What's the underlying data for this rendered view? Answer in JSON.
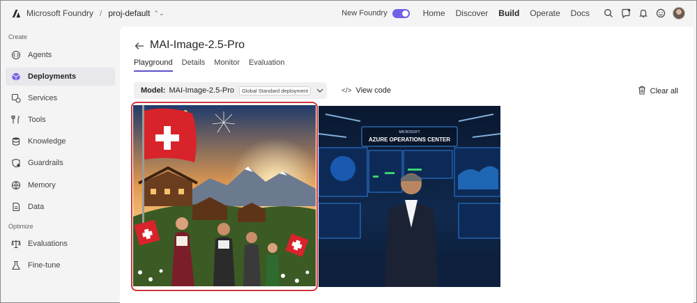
{
  "topbar": {
    "brand": "Microsoft Foundry",
    "separator": "/",
    "project": "proj-default",
    "new_foundry_label": "New Foundry",
    "new_foundry_on": true,
    "nav": [
      "Home",
      "Discover",
      "Build",
      "Operate",
      "Docs"
    ],
    "active_nav": "Build",
    "icons": [
      "search-icon",
      "chat-bubble-icon",
      "bell-icon",
      "smiley-icon",
      "avatar"
    ],
    "accent_color": "#7160e8"
  },
  "sidebar": {
    "sections": [
      {
        "label": "Create",
        "items": [
          {
            "label": "Agents",
            "icon": "agents-icon"
          },
          {
            "label": "Deployments",
            "icon": "deployments-icon",
            "active": true
          },
          {
            "label": "Services",
            "icon": "services-icon"
          },
          {
            "label": "Tools",
            "icon": "tools-icon"
          },
          {
            "label": "Knowledge",
            "icon": "knowledge-icon"
          },
          {
            "label": "Guardrails",
            "icon": "guardrails-icon"
          },
          {
            "label": "Memory",
            "icon": "memory-icon"
          },
          {
            "label": "Data",
            "icon": "data-icon"
          }
        ]
      },
      {
        "label": "Optimize",
        "items": [
          {
            "label": "Evaluations",
            "icon": "evaluations-icon"
          },
          {
            "label": "Fine-tune",
            "icon": "fine-tune-icon"
          }
        ]
      }
    ]
  },
  "main": {
    "title": "MAI-Image-2.5-Pro",
    "tabs": [
      "Playground",
      "Details",
      "Monitor",
      "Evaluation"
    ],
    "active_tab": "Playground",
    "model_label": "Model:",
    "model_value": "MAI-Image-2.5-Pro",
    "deployment_badge": "Global Standard deployment",
    "view_code": "View code",
    "clear_all": "Clear all",
    "images": [
      {
        "subject": "swiss-alpine-celebration-image",
        "selected": true
      },
      {
        "subject": "azure-operations-center-image",
        "caption_text": "AZURE OPERATIONS CENTER",
        "logo_text": "MICROSOFT",
        "selected": false
      }
    ],
    "highlight_color": "#d13438"
  }
}
